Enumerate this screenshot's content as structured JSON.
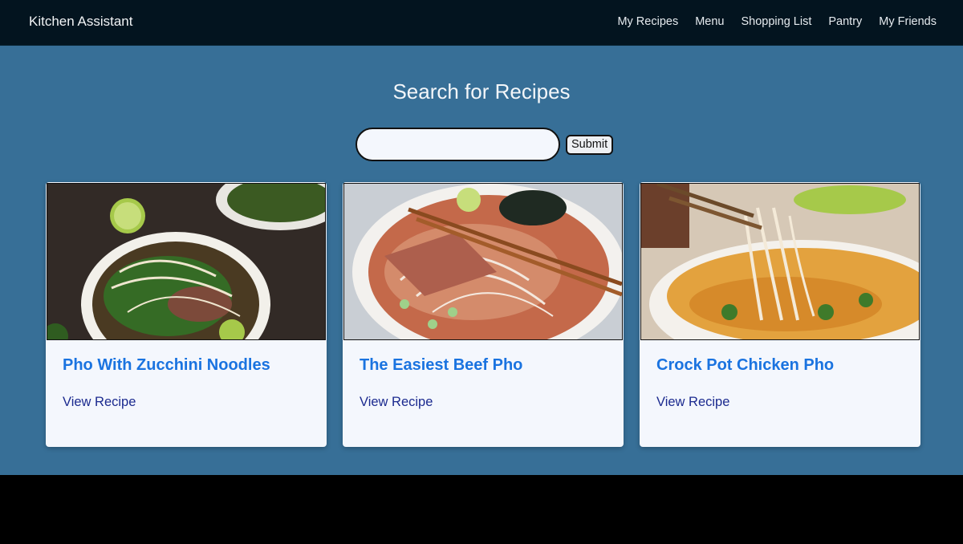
{
  "app": {
    "brand": "Kitchen Assistant"
  },
  "nav": {
    "items": [
      {
        "label": "My Recipes"
      },
      {
        "label": "Menu"
      },
      {
        "label": "Shopping List"
      },
      {
        "label": "Pantry"
      },
      {
        "label": "My Friends"
      }
    ]
  },
  "search": {
    "title": "Search for Recipes",
    "value": "",
    "placeholder": "",
    "submit_label": "Submit"
  },
  "recipes": [
    {
      "title": "Pho With Zucchini Noodles",
      "link_label": "View Recipe"
    },
    {
      "title": "The Easiest Beef Pho",
      "link_label": "View Recipe"
    },
    {
      "title": "Crock Pot Chicken Pho",
      "link_label": "View Recipe"
    }
  ],
  "colors": {
    "navbar_bg": "#03141f",
    "main_bg": "#376f97",
    "card_bg": "#f4f7fd",
    "recipe_title": "#1a73e0",
    "recipe_link": "#1b2a8f",
    "footer_bg": "#000000"
  }
}
